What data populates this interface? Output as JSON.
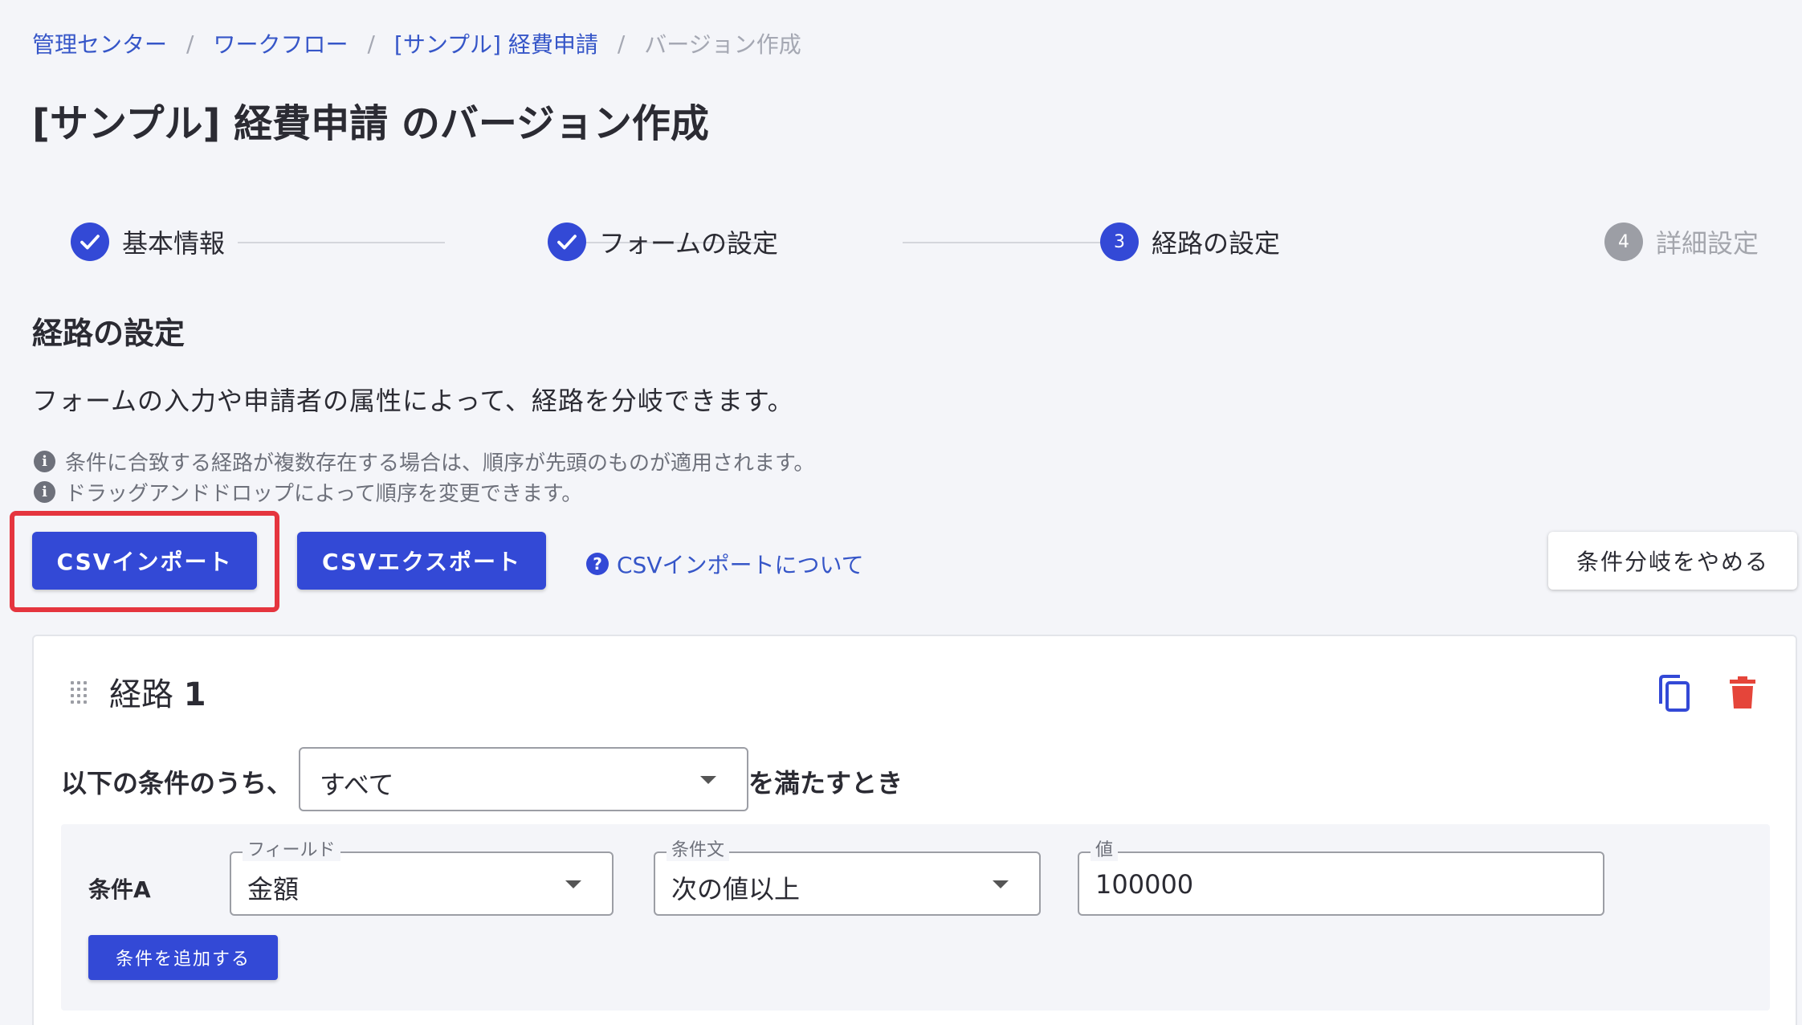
{
  "breadcrumb": {
    "items": [
      "管理センター",
      "ワークフロー",
      "[サンプル] 経費申請"
    ],
    "current": "バージョン作成",
    "separator": "/"
  },
  "page_title": "[サンプル] 経費申請 のバージョン作成",
  "stepper": {
    "steps": [
      {
        "label": "基本情報",
        "state": "done"
      },
      {
        "label": "フォームの設定",
        "state": "done"
      },
      {
        "label": "経路の設定",
        "state": "active",
        "number": "3"
      },
      {
        "label": "詳細設定",
        "state": "pending",
        "number": "4"
      }
    ]
  },
  "section": {
    "title": "経路の設定",
    "description": "フォームの入力や申請者の属性によって、経路を分岐できます。",
    "notes": [
      "条件に合致する経路が複数存在する場合は、順序が先頭のものが適用されます。",
      "ドラッグアンドドロップによって順序を変更できます。"
    ]
  },
  "actions": {
    "csv_import": "CSVインポート",
    "csv_export": "CSVエクスポート",
    "csv_help": "CSVインポートについて",
    "stop_branching": "条件分岐をやめる"
  },
  "route": {
    "title_prefix": "経路",
    "number": "1",
    "condition_prefix": "以下の条件のうち、",
    "match_mode": "すべて",
    "condition_suffix": "を満たすとき",
    "conditions": [
      {
        "name": "条件A",
        "field_label": "フィールド",
        "field_value": "金額",
        "operator_label": "条件文",
        "operator_value": "次の値以上",
        "value_label": "値",
        "value": "100000"
      }
    ],
    "add_condition": "条件を追加する"
  },
  "colors": {
    "primary": "#3349d6",
    "link": "#3656c8",
    "danger": "#e5453a",
    "highlight": "#e5353f",
    "background": "#f4f5f9"
  },
  "icons": [
    "check-icon",
    "info-icon",
    "help-icon",
    "drag-handle-icon",
    "copy-icon",
    "trash-icon",
    "chevron-down-icon"
  ]
}
